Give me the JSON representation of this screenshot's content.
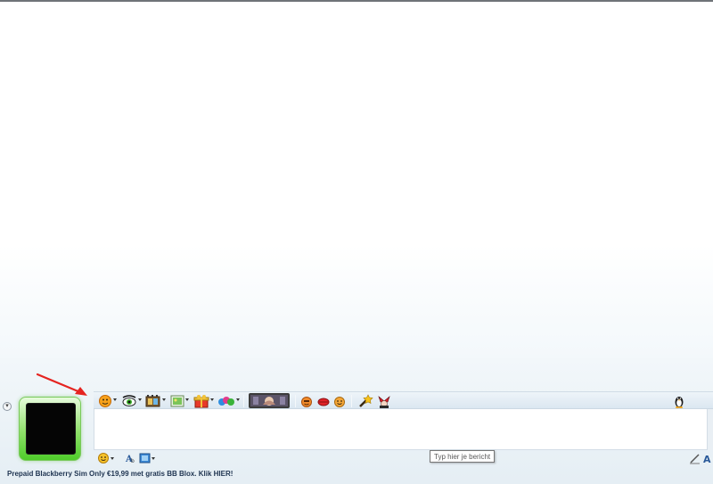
{
  "toolbar": {
    "items": [
      {
        "icon": "emoticon-icon",
        "has_dropdown": true
      },
      {
        "icon": "wink-eyes-icon",
        "has_dropdown": true
      },
      {
        "icon": "film-icon",
        "has_dropdown": true
      },
      {
        "icon": "background-picture-icon",
        "has_dropdown": true
      },
      {
        "icon": "gift-icon",
        "has_dropdown": true
      },
      {
        "icon": "games-icon",
        "has_dropdown": true
      },
      {
        "icon": "wink-preview-icon",
        "has_dropdown": false
      },
      {
        "icon": "smiley-face-icon",
        "has_dropdown": false
      },
      {
        "icon": "kiss-lips-icon",
        "has_dropdown": false
      },
      {
        "icon": "grin-face-icon",
        "has_dropdown": false
      },
      {
        "icon": "magic-wand-icon",
        "has_dropdown": false
      },
      {
        "icon": "jester-icon",
        "has_dropdown": false
      }
    ],
    "right_icon": "penguin-icon"
  },
  "input": {
    "tooltip": "Typ hier je bericht"
  },
  "format_toolbar": {
    "emoticons_icon": "emoticon-icon",
    "font_icon": "font-icon",
    "background_icon": "background-icon",
    "handwriting_icon": "handwriting-pen-icon",
    "text_mode_icon": "text-mode-icon"
  },
  "ad": {
    "text": "Prepaid Blackberry Sim Only €19,99 met gratis BB Blox. Klik HIER!"
  },
  "colors": {
    "accent_green": "#58cc2e",
    "arrow_red": "#e52420",
    "toolbar_bg": "#dbe7f1",
    "ad_text": "#1e3350"
  }
}
